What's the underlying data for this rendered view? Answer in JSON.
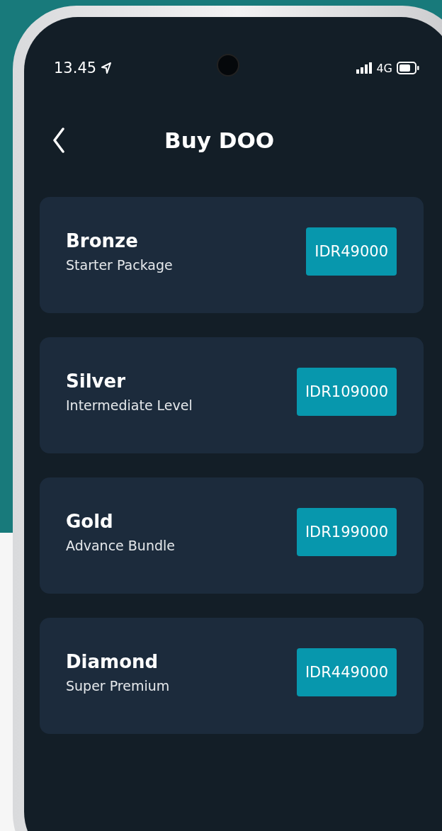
{
  "status_bar": {
    "time": "13.45",
    "network": "4G"
  },
  "header": {
    "title": "Buy DOO"
  },
  "packages": [
    {
      "name": "Bronze",
      "description": "Starter Package",
      "price": "IDR49000"
    },
    {
      "name": "Silver",
      "description": "Intermediate Level",
      "price": "IDR109000"
    },
    {
      "name": "Gold",
      "description": "Advance Bundle",
      "price": "IDR199000"
    },
    {
      "name": "Diamond",
      "description": "Super Premium",
      "price": "IDR449000"
    }
  ]
}
